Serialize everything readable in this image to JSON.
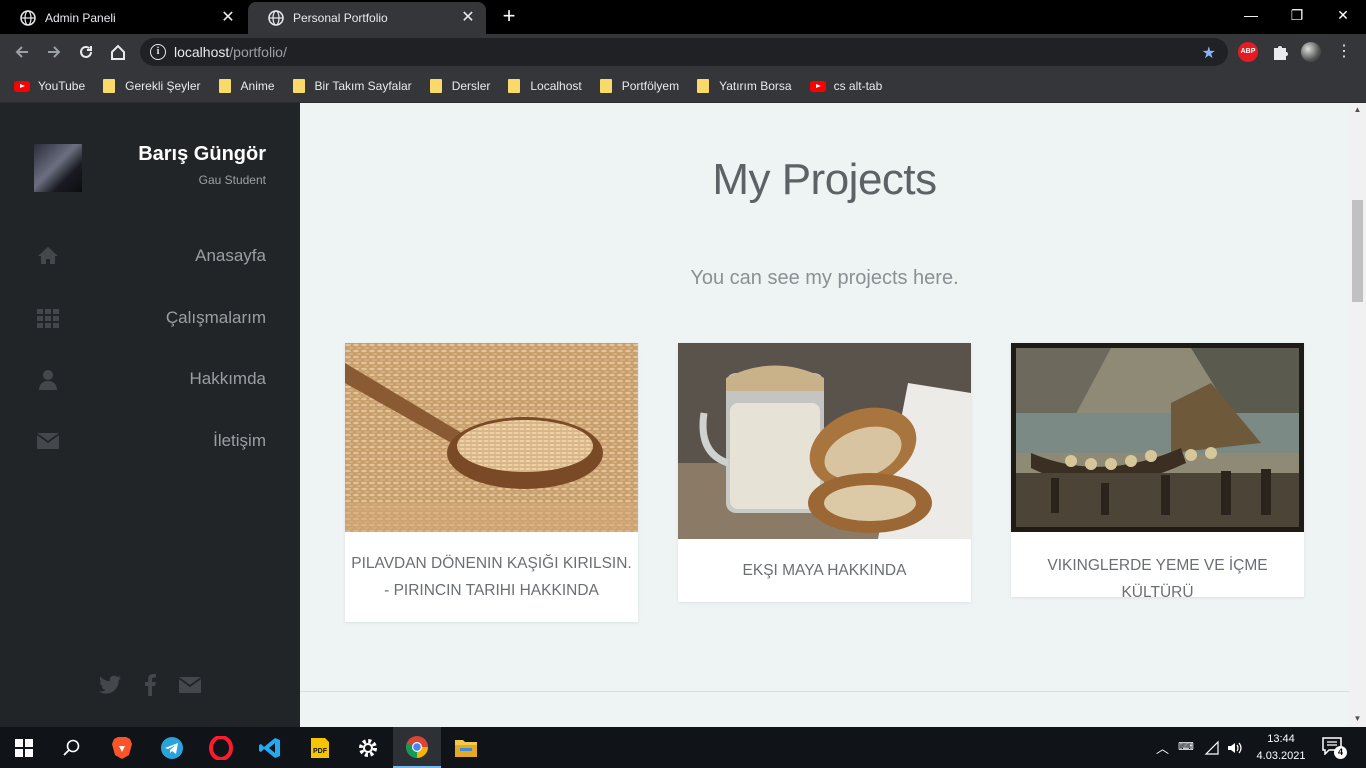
{
  "browser": {
    "tabs": [
      {
        "title": "Admin Paneli",
        "active": false
      },
      {
        "title": "Personal Portfolio",
        "active": true
      }
    ],
    "url_host": "localhost",
    "url_path": "/portfolio/",
    "bookmarks": [
      {
        "label": "YouTube",
        "icon": "youtube-icon"
      },
      {
        "label": "Gerekli Şeyler",
        "icon": "folder-icon"
      },
      {
        "label": "Anime",
        "icon": "folder-icon"
      },
      {
        "label": "Bir Takım Sayfalar",
        "icon": "folder-icon"
      },
      {
        "label": "Dersler",
        "icon": "folder-icon"
      },
      {
        "label": "Localhost",
        "icon": "folder-icon"
      },
      {
        "label": "Portfölyem",
        "icon": "folder-icon"
      },
      {
        "label": "Yatırım Borsa",
        "icon": "folder-icon"
      },
      {
        "label": "cs alt-tab",
        "icon": "youtube-icon"
      }
    ],
    "extension_badge": "ABP"
  },
  "sidebar": {
    "name": "Barış Güngör",
    "subtitle": "Gau Student",
    "items": [
      {
        "label": "Anasayfa",
        "icon": "home-icon"
      },
      {
        "label": "Çalışmalarım",
        "icon": "grid-icon"
      },
      {
        "label": "Hakkımda",
        "icon": "user-icon"
      },
      {
        "label": "İletişim",
        "icon": "envelope-icon"
      }
    ],
    "social": [
      "twitter-icon",
      "facebook-icon",
      "envelope-icon"
    ]
  },
  "main": {
    "heading": "My Projects",
    "subheading": "You can see my projects here.",
    "projects": [
      {
        "title": "PILAVDAN DÖNENIN KAŞIĞI KIRILSIN. - PIRINCIN TARIHI HAKKINDA",
        "image": "rice-spoon"
      },
      {
        "title": "EKŞI MAYA HAKKINDA",
        "image": "sourdough-bread"
      },
      {
        "title": "VIKINGLERDE YEME VE İÇME KÜLTÜRÜ",
        "image": "viking-painting"
      }
    ]
  },
  "taskbar": {
    "time": "13:44",
    "date": "4.03.2021",
    "notifications": "4"
  },
  "colors": {
    "sidebar_bg": "#222528",
    "main_bg": "#eef3f3",
    "accent_star": "#8ab4f8"
  }
}
